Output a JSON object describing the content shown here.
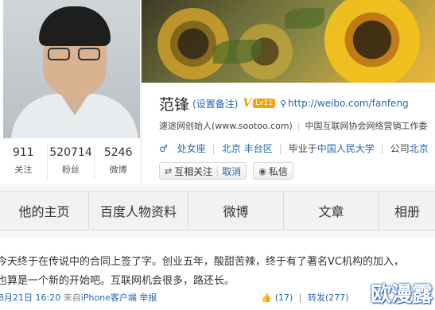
{
  "profile": {
    "name": "范锋",
    "remark": "(设置备注)",
    "verified_badge": "V",
    "vip_badge": "Lv11",
    "url": "http://weibo.com/fanfeng",
    "intro": "速途网创始人(www.sootoo.com)",
    "intro_more": "中国互联网协会网络营销工作委",
    "gender_symbol": "♂",
    "location_province": "处女座",
    "location_city": "北京 丰台区",
    "school_prefix": "毕业于",
    "school": "中国人民大学",
    "company_prefix": "公司",
    "company": "北京"
  },
  "stats": [
    {
      "num": "911",
      "label": "关注"
    },
    {
      "num": "520714",
      "label": "粉丝"
    },
    {
      "num": "5246",
      "label": "微博"
    }
  ],
  "buttons": {
    "mutual_follow": "互相关注",
    "cancel": "取消",
    "message": "私信"
  },
  "tabs": [
    "他的主页",
    "百度人物资料",
    "微博",
    "文章",
    "相册"
  ],
  "post": {
    "line1": "今天终于在传说中的合同上签了字。创业五年，酸甜苦辣，终于有了著名VC机构的加入，",
    "line2": "也算是一个新的开始吧。互联网机会很多，路还长。",
    "date": "8月21日 16:20",
    "source_prefix": "来自",
    "source": "iPhone客户端",
    "report": "举报",
    "likes": "(17)",
    "repost": "转发(277)",
    "repost_sep": "|"
  },
  "watermark": "欧漫露",
  "colors": {
    "link": "#2467b3",
    "badge": "#e8a400"
  }
}
